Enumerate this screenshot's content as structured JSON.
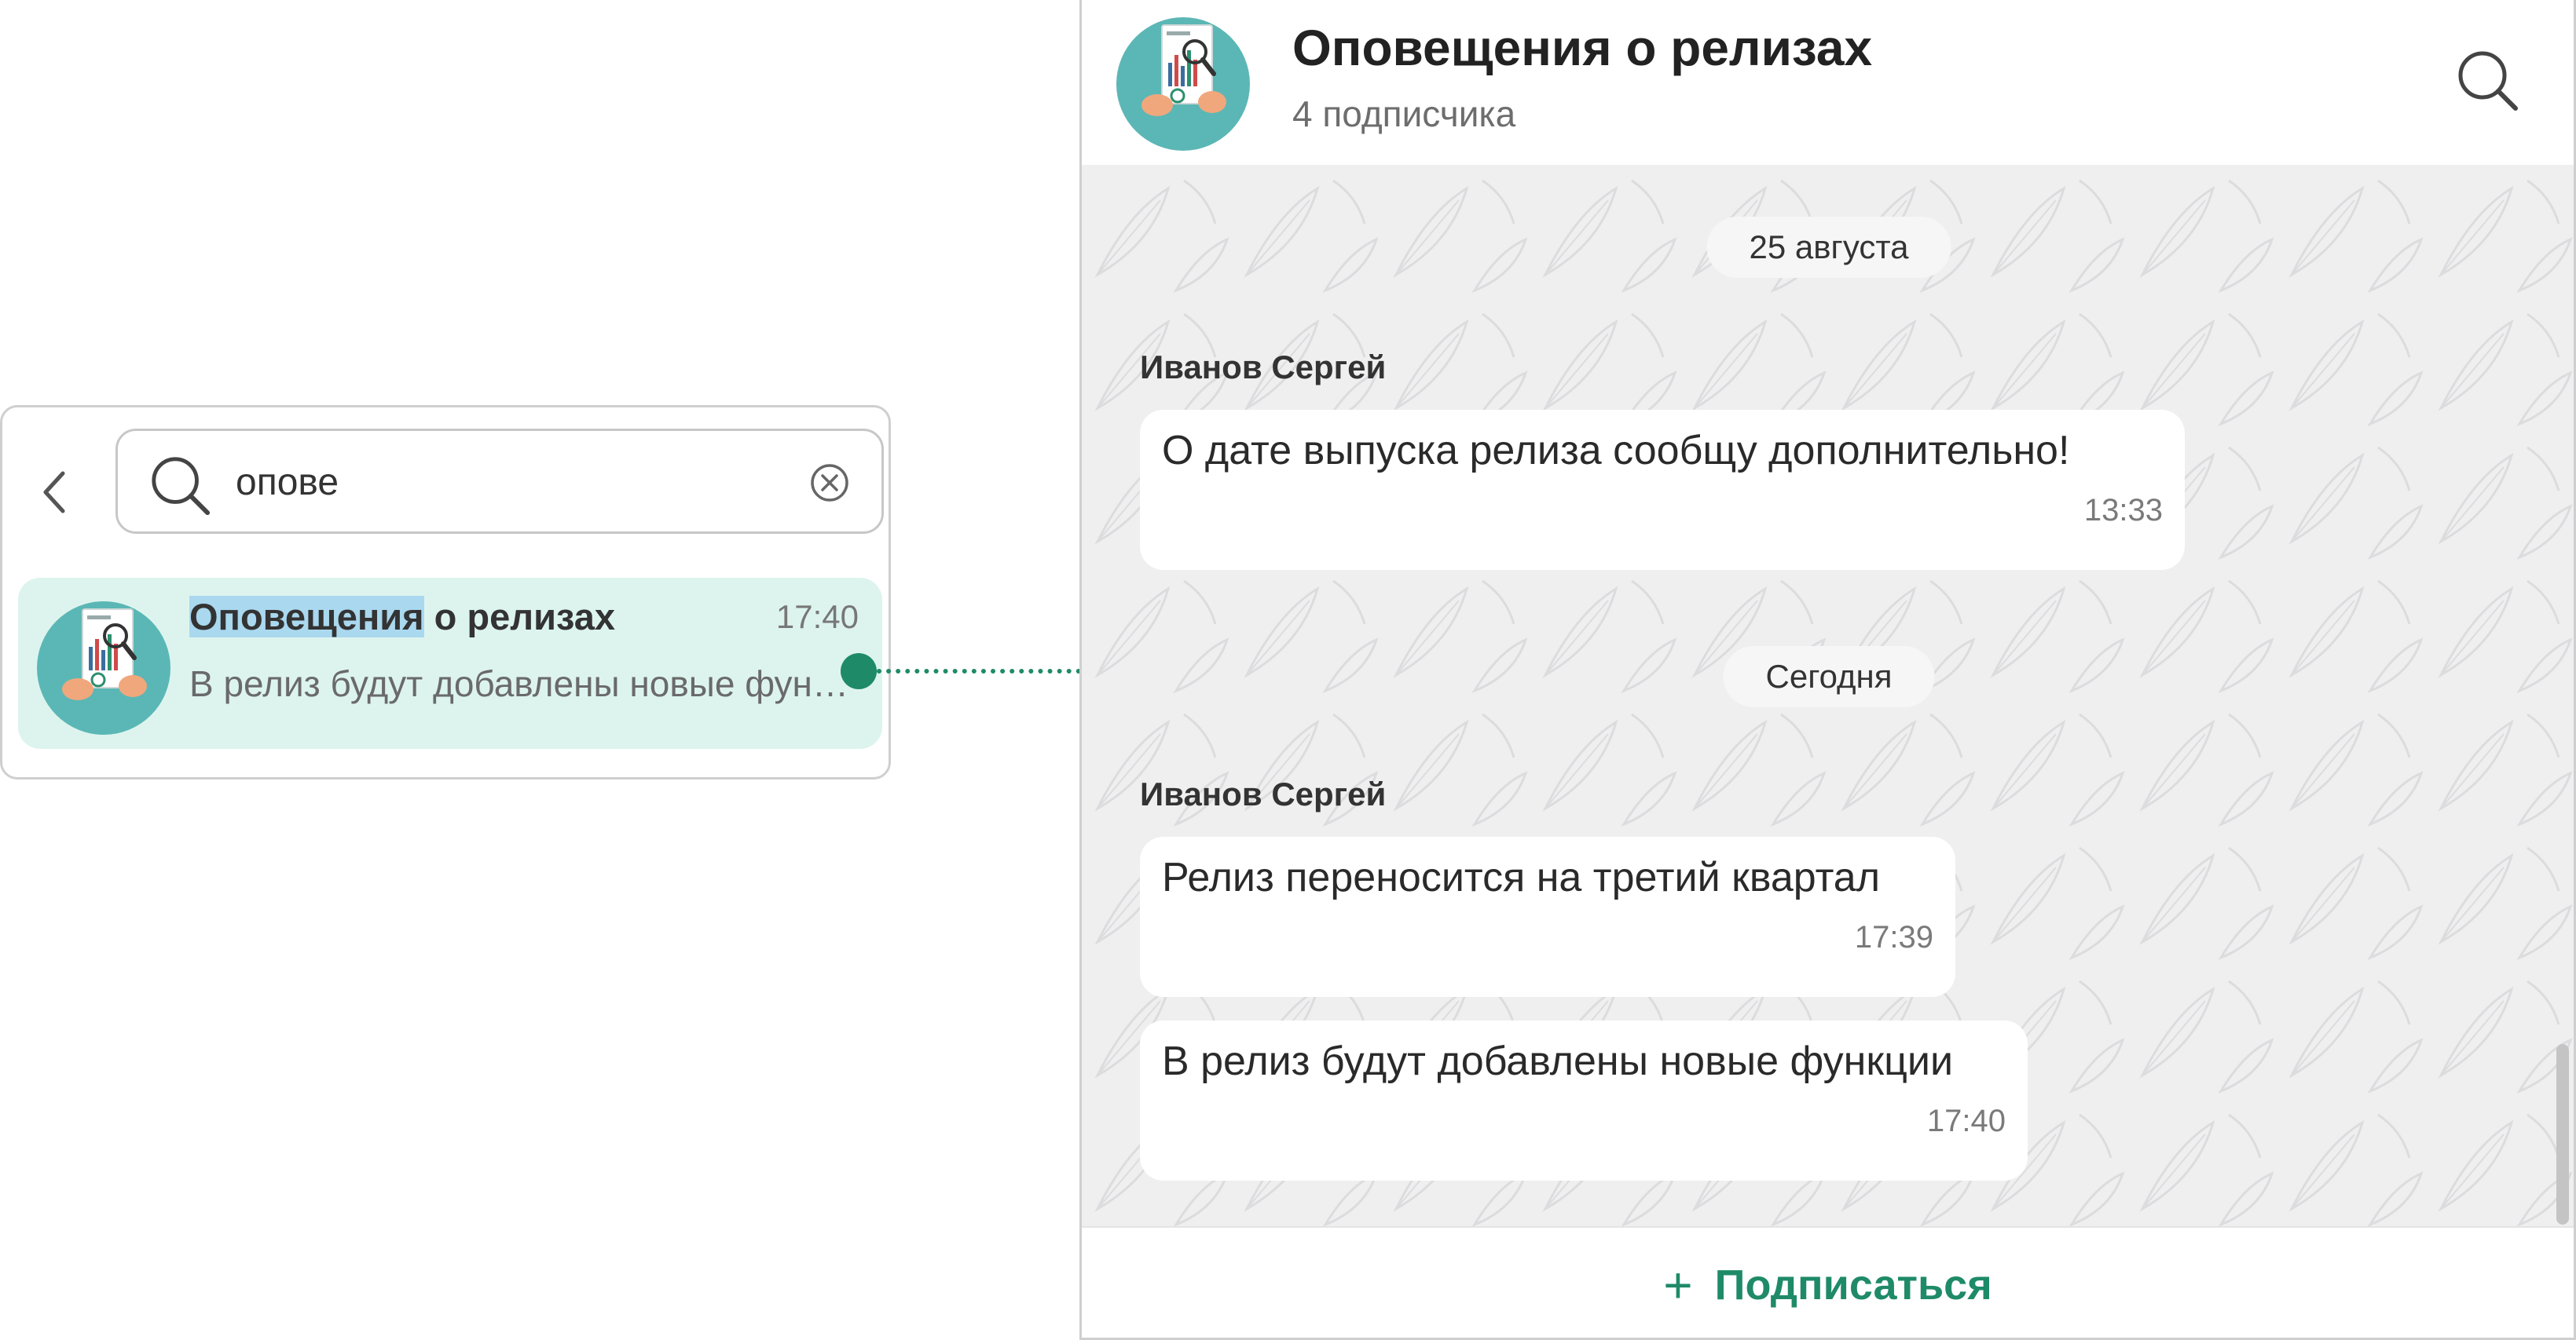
{
  "search": {
    "query": "опове",
    "result": {
      "title_highlight": "Оповещения",
      "title_rest": " о релизах",
      "time": "17:40",
      "preview": "В релиз будут добавлены новые функции"
    }
  },
  "channel": {
    "title": "Оповещения о релизах",
    "subscribers": "4 подписчика",
    "messages": [
      {
        "date": "25 августа",
        "sender": "Иванов Сергей",
        "text": "О дате выпуска релиза сообщу дополнительно!",
        "time": "13:33"
      },
      {
        "date": "Сегодня",
        "sender": "Иванов Сергей",
        "text": "Релиз переносится на третий квартал",
        "time": "17:39"
      },
      {
        "text": "В релиз будут добавлены новые функции",
        "time": "17:40"
      }
    ],
    "subscribe_label": "Подписаться",
    "subscribe_plus": "+"
  },
  "colors": {
    "accent": "#1f8a68",
    "result_bg": "#ddf4ee",
    "highlight": "#a9d8ef",
    "feed_bg": "#efeff0"
  },
  "icons": [
    "back-chevron-icon",
    "search-icon",
    "clear-icon",
    "channel-avatar-icon",
    "plus-icon"
  ]
}
